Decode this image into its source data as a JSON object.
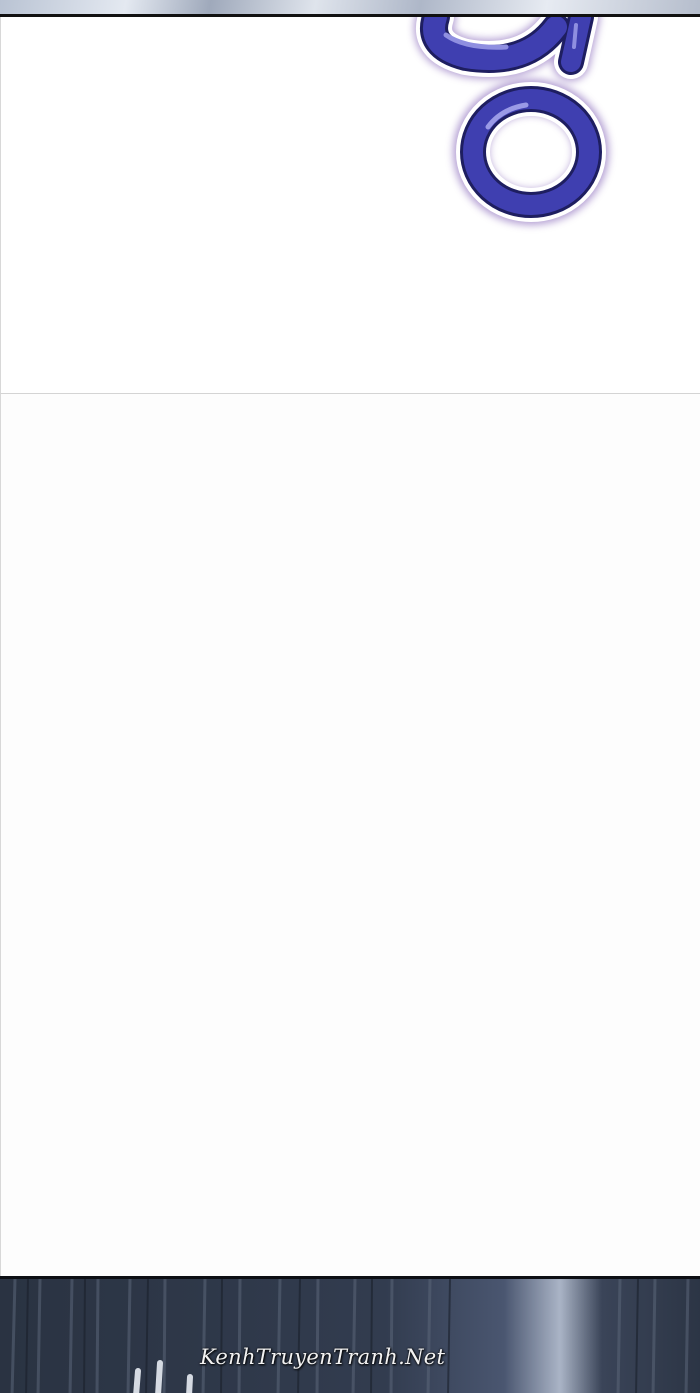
{
  "strip": {
    "watermark_text": "KenhTruyenTranh.Net"
  },
  "colors": {
    "sfx_fill": "#3f3fb0",
    "sfx_outline": "#ffffff",
    "sfx_glow": "#9a7fc4",
    "panel_border": "#111111",
    "bottom_panel": "#2c3545"
  }
}
